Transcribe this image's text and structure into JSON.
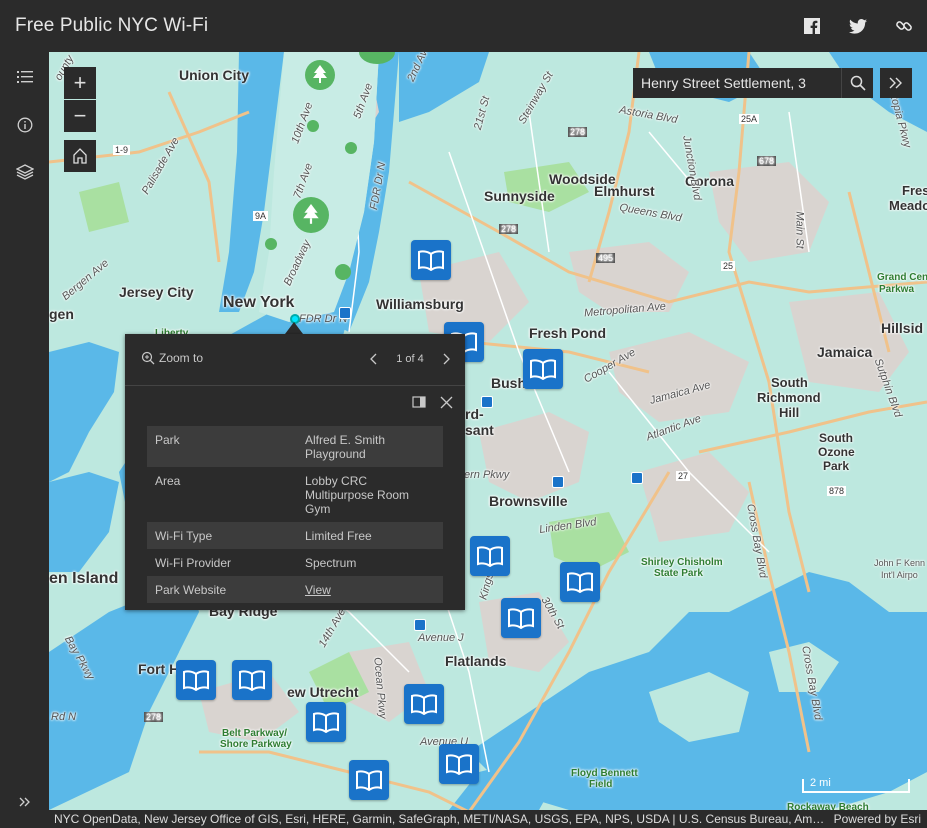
{
  "header": {
    "title": "Free Public NYC Wi-Fi",
    "share": [
      "facebook-icon",
      "twitter-icon",
      "link-icon"
    ]
  },
  "rail": {
    "items": [
      "legend-icon",
      "info-icon",
      "layers-icon"
    ],
    "expand": "expand-icon"
  },
  "map_controls": {
    "zoom_in": "+",
    "zoom_out": "−"
  },
  "search": {
    "value": "Henry Street Settlement, 3"
  },
  "map_labels": {
    "union_city": "Union City",
    "jersey_city": "Jersey City",
    "new_york": "New York",
    "williamsburg": "Williamsburg",
    "woodside": "Woodside",
    "elmhurst": "Elmhurst",
    "corona": "Corona",
    "sunnyside": "Sunnyside",
    "fresh_pond": "Fresh Pond",
    "jamaica": "Jamaica",
    "hillside": "Hillsid",
    "fresh_meadows_1": "Fres",
    "fresh_meadows_2": "Meado",
    "south_richmond_1": "South",
    "south_richmond_2": "Richmond",
    "south_richmond_3": "Hill",
    "south_ozone_1": "South",
    "south_ozone_2": "Ozone",
    "south_ozone_3": "Park",
    "bush": "Bush",
    "ford": "rd-",
    "sant": "sant",
    "brownsville": "Brownsville",
    "flatlands": "Flatlands",
    "staten": "en Island",
    "bay_ridge": "Bay Ridge",
    "fort_h": "Fort H",
    "new_utrecht": "ew Utrecht",
    "gen": "gen",
    "grand_cen_1": "Grand Cen",
    "grand_cen_2": "Parkwa",
    "jfk_1": "John F Kenn",
    "jfk_2": "Int'l Airpo",
    "shirley_1": "Shirley Chisholm",
    "shirley_2": "State Park",
    "floyd_1": "Floyd Bennett",
    "floyd_2": "Field",
    "belt_1": "Belt Parkway/",
    "belt_2": "Shore Parkway",
    "rockaway": "Rockaway Beach",
    "liberty": "Liberty",
    "astoria": "Astoria Blvd",
    "queens": "Queens Blvd",
    "metropolitan": "Metropolitan Ave",
    "cooper": "Cooper Ave",
    "jamaica_ave": "Jamaica Ave",
    "atlantic": "Atlantic Ave",
    "linden": "Linden Blvd",
    "eastern": "ern Pkwy",
    "crossbay1": "Cross Bay Blvd",
    "crossbay2": "Cross Bay Blvd",
    "ocean": "Ocean Pkwy",
    "kings": "Kings H",
    "avenue_j": "Avenue J",
    "avenue_u": "Avenue U",
    "fdr": "FDR Dr N",
    "fdr2": "FDR Dr N",
    "broadway": "Broadway",
    "10th": "10th Ave",
    "7th": "7th Ave",
    "5th": "5th Ave",
    "2nd": "2nd Ave",
    "21st": "21st St",
    "steinway": "Steinway St",
    "junction": "Junction Blvd",
    "main": "Main St",
    "sutphin": "Sutphin Blvd",
    "palisade": "Palisade Ave",
    "bergen": "Bergen Ave",
    "bay_pkwy": "Bay Pkwy",
    "14th": "14th Ave",
    "30th": "30th St",
    "rd_n": "Rd N",
    "county": "ounty",
    "utopia": "Utopia Pkwy",
    "s1_9": "1-9",
    "s9a": "9A",
    "s278a": "278",
    "s278b": "278",
    "s278c": "278",
    "s25a": "25A",
    "s678": "678",
    "s495": "495",
    "s25": "25",
    "s27": "27",
    "s878": "878"
  },
  "popup": {
    "zoom_to": "Zoom to",
    "pager": "1 of 4",
    "rows": [
      {
        "key": "Park",
        "value": "Alfred E. Smith Playground"
      },
      {
        "key": "Area",
        "value": "Lobby CRC Multipurpose Room Gym"
      },
      {
        "key": "Wi-Fi Type",
        "value": "Limited Free"
      },
      {
        "key": "Wi-Fi Provider",
        "value": "Spectrum"
      },
      {
        "key": "Park Website",
        "value": "View"
      }
    ]
  },
  "scalebar": "2 mi",
  "attribution": {
    "text": "NYC OpenData, New Jersey Office of GIS, Esri, HERE, Garmin, SafeGraph, METI/NASA, USGS, EPA, NPS, USDA | U.S. Census Bureau, Ameri…",
    "powered": "Powered by Esri"
  },
  "colors": {
    "chrome": "#2b2b2b",
    "library_marker": "#1a73c9",
    "park_marker": "#57b563",
    "water": "#5ab8e8",
    "land": "#bde8df"
  }
}
